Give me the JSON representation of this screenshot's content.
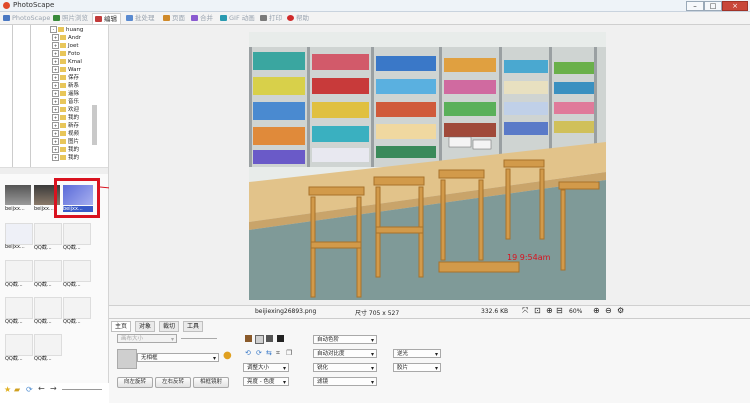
{
  "window": {
    "title": "PhotoScape",
    "min": "–",
    "max": "□",
    "close": "×"
  },
  "tabs": [
    {
      "label": "PhotoScape",
      "color": "#4a78c2"
    },
    {
      "label": "照片浏览",
      "color": "#3a8a3a"
    },
    {
      "label": "编辑",
      "color": "#c23a3a"
    },
    {
      "label": "批处理",
      "color": "#5a8ad0"
    },
    {
      "label": "页面",
      "color": "#d08a2a"
    },
    {
      "label": "合并",
      "color": "#8a5ad0"
    },
    {
      "label": "GIF 动画",
      "color": "#2a9ab0"
    },
    {
      "label": "打印",
      "color": "#7a7a7a"
    },
    {
      "label": "帮助",
      "color": "#d02a2a"
    }
  ],
  "tree": [
    "huang",
    "Andr",
    "Joet",
    "Foto",
    "Kmal",
    "Warr",
    "保存",
    "新系",
    "遥除",
    "音乐",
    "欢迎",
    "我的",
    "新存",
    "视频",
    "图片",
    "我的",
    "我的"
  ],
  "thumbnails": [
    {
      "label": "beijxx..."
    },
    {
      "label": "beijxx..."
    },
    {
      "label": "beijxx..."
    },
    {
      "label": "beijxx..."
    },
    {
      "label": "QQ截..."
    },
    {
      "label": "QQ截..."
    },
    {
      "label": "QQ截..."
    },
    {
      "label": "QQ截..."
    },
    {
      "label": "QQ截..."
    },
    {
      "label": "QQ截..."
    },
    {
      "label": "QQ截..."
    },
    {
      "label": "QQ截..."
    },
    {
      "label": "QQ截..."
    },
    {
      "label": "QQ截..."
    }
  ],
  "photo": {
    "watermark": "19 9:54am"
  },
  "status": {
    "filename": "beijiexing26893.png",
    "dimensions": "尺寸 705 x 527",
    "filesize": "332.6 KB",
    "zoom": "60%"
  },
  "panel": {
    "tabs": [
      "主页",
      "对象",
      "裁切",
      "工具"
    ],
    "frame_placeholder": "无相框",
    "buttons": {
      "rotate": "向左旋转",
      "flip": "左右反转",
      "mirror": "相框镜射",
      "auto_level": "自动色阶",
      "auto_contrast": "自动对比度",
      "resize": "调整大小",
      "sharpen": "锐化",
      "brightness": "亮度 - 色度",
      "filter": "滤镜",
      "backlight": "逆光",
      "film": "胶片"
    },
    "frame_input_placeholder": "画布大小"
  }
}
